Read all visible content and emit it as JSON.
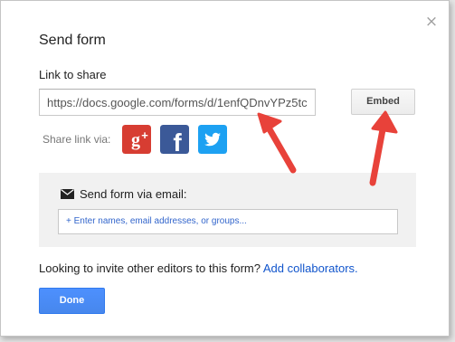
{
  "dialog": {
    "title": "Send form",
    "close_label": "×"
  },
  "link": {
    "label": "Link to share",
    "value": "https://docs.google.com/forms/d/1enfQDnvYPz5tc",
    "embed_label": "Embed"
  },
  "share": {
    "label": "Share link via:",
    "networks": [
      {
        "name": "Google+",
        "icon": "google-plus-icon",
        "glyph": "g+",
        "color": "#d73d32"
      },
      {
        "name": "Facebook",
        "icon": "facebook-icon",
        "glyph": "f",
        "color": "#3b5998"
      },
      {
        "name": "Twitter",
        "icon": "twitter-icon",
        "glyph": "",
        "color": "#1da1f2"
      }
    ]
  },
  "email": {
    "label": "Send form via email:",
    "placeholder": "+ Enter names, email addresses, or groups..."
  },
  "invite": {
    "text": "Looking to invite other editors to this form?",
    "link": "Add collaborators."
  },
  "actions": {
    "done_label": "Done"
  },
  "colors": {
    "primary_button": "#4d90fe",
    "link": "#1155cc",
    "annotation_arrow": "#e8423a"
  }
}
